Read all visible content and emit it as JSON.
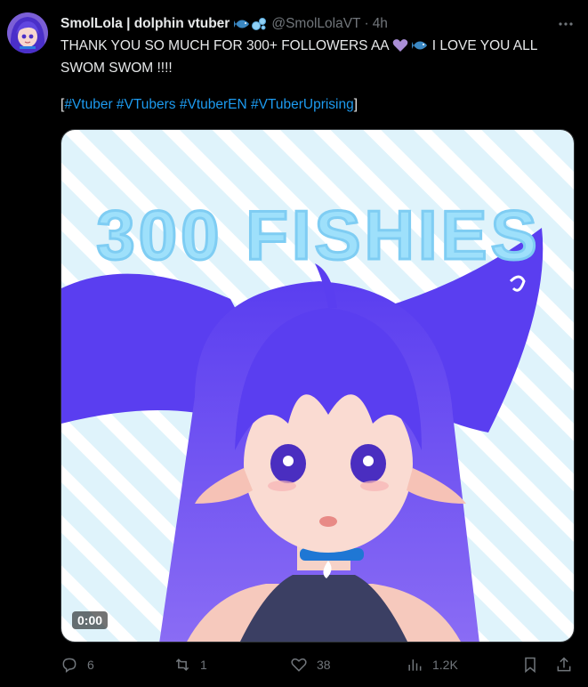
{
  "tweet": {
    "display_name": "SmolLola | dolphin vtuber",
    "handle": "@SmolLolaVT",
    "separator": "·",
    "time": "4h",
    "text_line1_a": "THANK YOU SO MUCH FOR 300+ FOLLOWERS AA",
    "text_line1_b": "I LOVE YOU ALL",
    "text_line2": "SWOM SWOM !!!!",
    "bracket_open": "[",
    "bracket_close": "]",
    "hashtags": [
      "#Vtuber",
      "#VTubers",
      "#VtuberEN",
      "#VTuberUprising"
    ],
    "media": {
      "overlay_text": "300 FISHIES",
      "video_timestamp": "0:00"
    },
    "actions": {
      "replies": "6",
      "reposts": "1",
      "likes": "38",
      "views": "1.2K"
    }
  },
  "icons": {
    "more": "more-dots-icon",
    "reply": "reply-icon",
    "repost": "repost-icon",
    "like": "heart-icon",
    "views": "views-icon",
    "bookmark": "bookmark-icon",
    "share": "share-icon"
  },
  "colors": {
    "background": "#000000",
    "text": "#e7e9ea",
    "muted": "#71767b",
    "link": "#1d9bf0",
    "heart_emoji": "#aa8ed6",
    "fish_emoji": "#3b88c3"
  }
}
